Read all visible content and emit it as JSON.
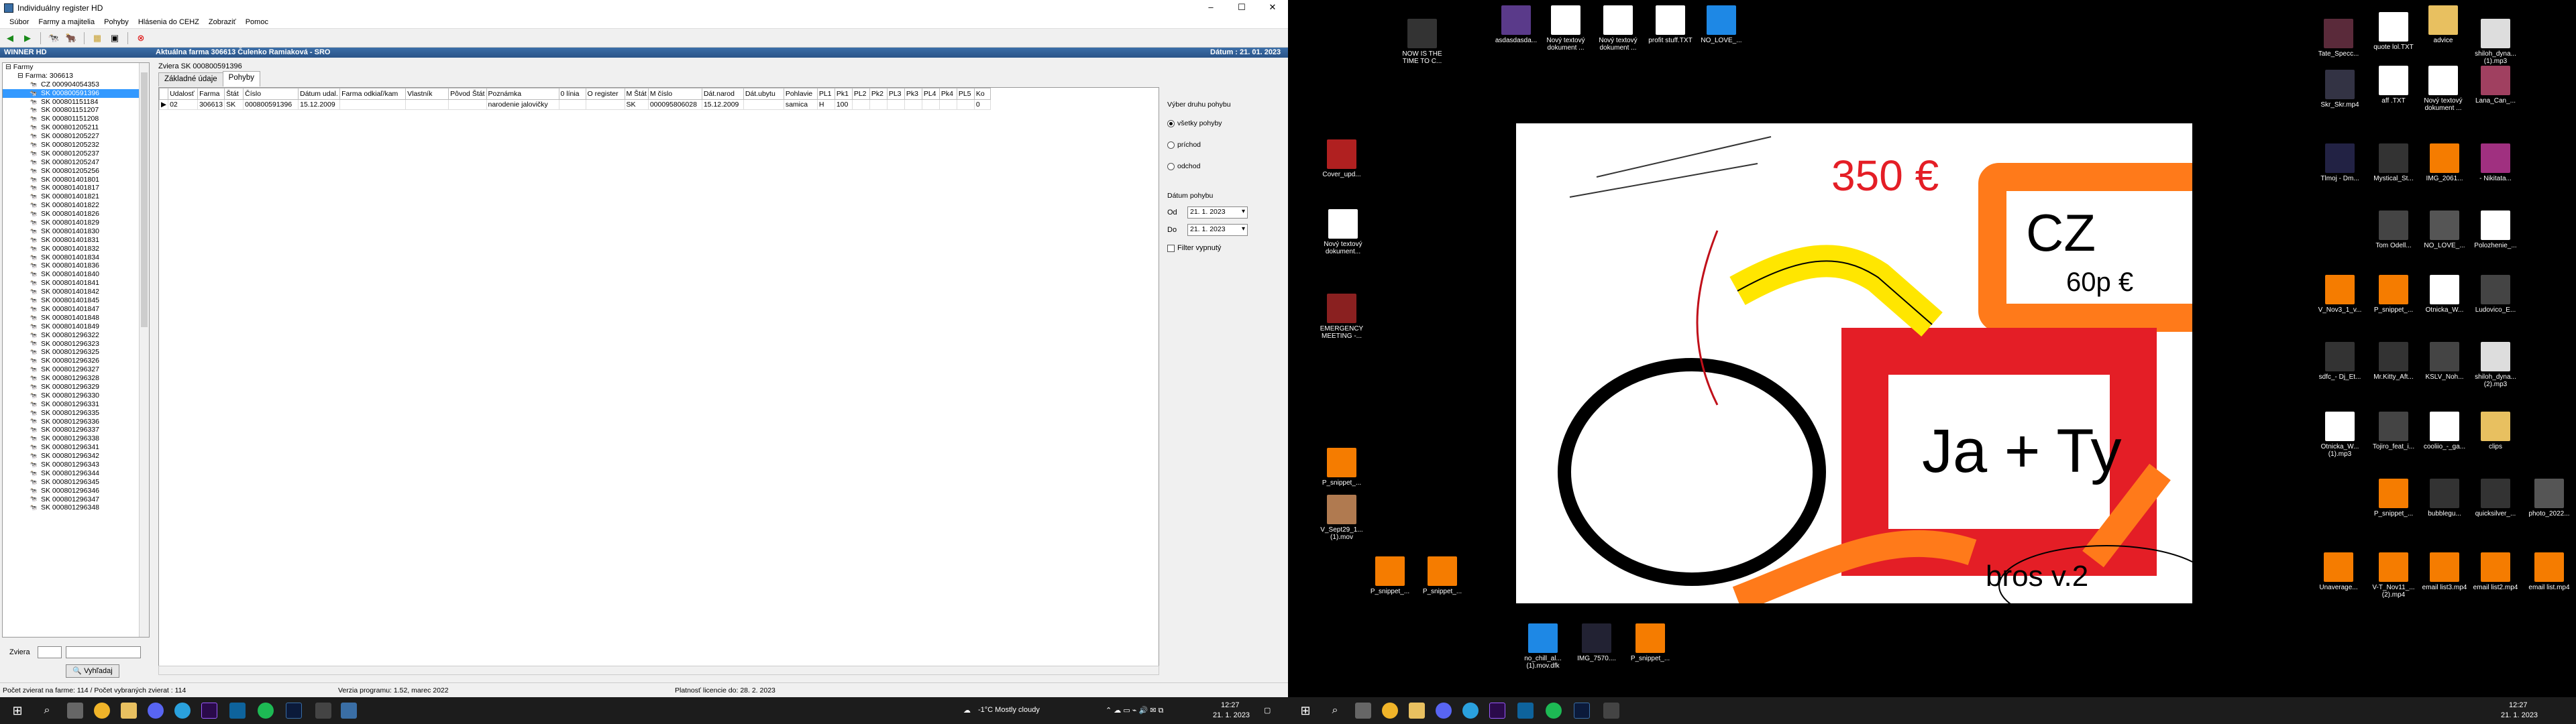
{
  "window": {
    "title": "Individuálny register HD",
    "menu": [
      "Súbor",
      "Farmy a majitelia",
      "Pohyby",
      "Hlásenia do CEHZ",
      "Zobraziť",
      "Pomoc"
    ],
    "header_left": "WINNER HD",
    "header_mid": "Aktuálna farma 306613 Čulenko Ramiaková - SRO",
    "header_right": "Dátum : 21. 01. 2023"
  },
  "tree": {
    "root": "Farmy",
    "farm": "Farma: 306613",
    "items": [
      "CZ 000904054353",
      "SK 000800591396",
      "SK 000801151184",
      "SK 000801151207",
      "SK 000801151208",
      "SK 000801205211",
      "SK 000801205227",
      "SK 000801205232",
      "SK 000801205237",
      "SK 000801205247",
      "SK 000801205256",
      "SK 000801401801",
      "SK 000801401817",
      "SK 000801401821",
      "SK 000801401822",
      "SK 000801401826",
      "SK 000801401829",
      "SK 000801401830",
      "SK 000801401831",
      "SK 000801401832",
      "SK 000801401834",
      "SK 000801401836",
      "SK 000801401840",
      "SK 000801401841",
      "SK 000801401842",
      "SK 000801401845",
      "SK 000801401847",
      "SK 000801401848",
      "SK 000801401849",
      "SK 000801296322",
      "SK 000801296323",
      "SK 000801296325",
      "SK 000801296326",
      "SK 000801296327",
      "SK 000801296328",
      "SK 000801296329",
      "SK 000801296330",
      "SK 000801296331",
      "SK 000801296335",
      "SK 000801296336",
      "SK 000801296337",
      "SK 000801296338",
      "SK 000801296341",
      "SK 000801296342",
      "SK 000801296343",
      "SK 000801296344",
      "SK 000801296345",
      "SK 000801296346",
      "SK 000801296347",
      "SK 000801296348"
    ],
    "selected_index": 1
  },
  "filter": {
    "label": "Zviera",
    "search_button": "Vyhľadaj"
  },
  "main": {
    "subtitle": "Zviera SK 000800591396",
    "tabs": [
      "Základné údaje",
      "Pohyby"
    ],
    "active_tab": 1,
    "columns": [
      "Udalosť",
      "Farma",
      "Štát",
      "Číslo",
      "Dátum udal.",
      "Farma odkiaľ/kam",
      "Vlastník",
      "Pôvod Štát",
      "Poznámka",
      "0 línia",
      "O register",
      "M Štát",
      "M číslo",
      "Dát.narod",
      "Dát.ubytu",
      "Pohlavie",
      "PL1",
      "Pk1",
      "PL2",
      "Pk2",
      "PL3",
      "Pk3",
      "PL4",
      "Pk4",
      "PL5",
      "Ko"
    ],
    "rows": [
      [
        "02",
        "306613",
        "SK",
        "000800591396",
        "15.12.2009",
        "",
        "",
        "",
        "narodenie jalovičky",
        "",
        "",
        "SK",
        "000095806028",
        "15.12.2009",
        "",
        "samica",
        "H",
        "100",
        "",
        "",
        "",
        "",
        "",
        "",
        "",
        "0"
      ]
    ]
  },
  "right_panel": {
    "group1": "Výber druhu pohybu",
    "options": [
      "všetky pohyby",
      "príchod",
      "odchod"
    ],
    "selected_option": 0,
    "group2": "Dátum pohybu",
    "from_label": "Od",
    "from_value": "21. 1. 2023",
    "to_label": "Do",
    "to_value": "21. 1. 2023",
    "filter_checkbox": "Filter vypnutý"
  },
  "status": {
    "left": "Počet zvierat na farme: 114 / Počet vybraných zvierat : 114",
    "mid": "Verzia programu: 1.52, marec 2022",
    "right": "Platnosť licencie do: 28. 2. 2023"
  },
  "taskbar1": {
    "weather": "-1°C  Mostly cloudy",
    "time": "12:27",
    "date": "21. 1. 2023"
  },
  "taskbar2": {
    "time": "12:27",
    "date": "21. 1. 2023"
  },
  "desktop_icons": [
    {
      "label": "NOW IS THE TIME TO C...",
      "color": "#333"
    },
    {
      "label": "asdasdasda...",
      "color": "#5a3a8a"
    },
    {
      "label": "Nový textový dokument ...",
      "color": "#fff"
    },
    {
      "label": "Nový textový dokument ...",
      "color": "#fff"
    },
    {
      "label": "profit stuff.TXT",
      "color": "#fff"
    },
    {
      "label": "NO_LOVE_...",
      "color": "#1e88e5"
    },
    {
      "label": "Tate_Specc...",
      "color": "#5a2a3a"
    },
    {
      "label": "quote lol.TXT",
      "color": "#fff"
    },
    {
      "label": "advice",
      "color": "#e8c060"
    },
    {
      "label": "shiloh_dyna... (1).mp3",
      "color": "#ddd"
    },
    {
      "label": "Cover_upd...",
      "color": "#b02020"
    },
    {
      "label": "Nový textový dokument...",
      "color": "#fff"
    },
    {
      "label": "EMERGENCY MEETING -...",
      "color": "#8a2020"
    },
    {
      "label": "P_snippet_...",
      "color": "#f57c00"
    },
    {
      "label": "V_Sept29_1... (1).mov",
      "color": "#b07a50"
    },
    {
      "label": "P_snippet_...",
      "color": "#f57c00"
    },
    {
      "label": "P_snippet_...",
      "color": "#f57c00"
    },
    {
      "label": "no_chill_al... (1).mov.dfk",
      "color": "#1e88e5"
    },
    {
      "label": "IMG_7570....",
      "color": "#223"
    },
    {
      "label": "P_snippet_...",
      "color": "#f57c00"
    },
    {
      "label": "Skr_Skr.mp4",
      "color": "#334"
    },
    {
      "label": "aff .TXT",
      "color": "#fff"
    },
    {
      "label": "Nový textový dokument ...",
      "color": "#fff"
    },
    {
      "label": "Lana_Can_...",
      "color": "#a04060"
    },
    {
      "label": "Tlmoj - Dm...",
      "color": "#224"
    },
    {
      "label": "Mystical_St...",
      "color": "#333"
    },
    {
      "label": "IMG_2061...",
      "color": "#f57c00"
    },
    {
      "label": "- Nikitata...",
      "color": "#a03080"
    },
    {
      "label": "Tom Odell...",
      "color": "#444"
    },
    {
      "label": "NO_LOVE_...",
      "color": "#555"
    },
    {
      "label": "Polozhenie_...",
      "color": "#fff"
    },
    {
      "label": "V_Nov3_1_v...",
      "color": "#f57c00"
    },
    {
      "label": "P_snippet_...",
      "color": "#f57c00"
    },
    {
      "label": "Otnicka_W...",
      "color": "#fff"
    },
    {
      "label": "Ludovico_E...",
      "color": "#444"
    },
    {
      "label": "Mr.Kitty_Aft...",
      "color": "#333"
    },
    {
      "label": "KSLV_Noh...",
      "color": "#444"
    },
    {
      "label": "shiloh_dyna... (2).mp3",
      "color": "#ddd"
    },
    {
      "label": "sdfc_- Dj_Et...",
      "color": "#333"
    },
    {
      "label": "Tojiro_feat_i...",
      "color": "#444"
    },
    {
      "label": "cooliio_-_ga...",
      "color": "#fff"
    },
    {
      "label": "clips",
      "color": "#e8c060"
    },
    {
      "label": "Otnicka_W... (1).mp3",
      "color": "#fff"
    },
    {
      "label": "P_snippet_...",
      "color": "#f57c00"
    },
    {
      "label": "bubblegu...",
      "color": "#333"
    },
    {
      "label": "quicksilver_...",
      "color": "#333"
    },
    {
      "label": "photo_2022...",
      "color": "#555"
    },
    {
      "label": "V-T_Nov11_... (2).mp4",
      "color": "#f57c00"
    },
    {
      "label": "email list3.mp4",
      "color": "#f57c00"
    },
    {
      "label": "email list2.mp4",
      "color": "#f57c00"
    },
    {
      "label": "email list.mp4",
      "color": "#f57c00"
    },
    {
      "label": "Unaverage...",
      "color": "#f57c00"
    }
  ],
  "drawing": {
    "price": "350 €",
    "cz": "CZ",
    "cz_price": "60p €",
    "ja_ty": "Ja + Ty",
    "bros": "bros v.2"
  },
  "colors": {
    "accent": "#3399ff",
    "header": "#2a5388",
    "orange": "#ff7a1a",
    "red": "#e41e26",
    "yellow": "#ffe600"
  }
}
